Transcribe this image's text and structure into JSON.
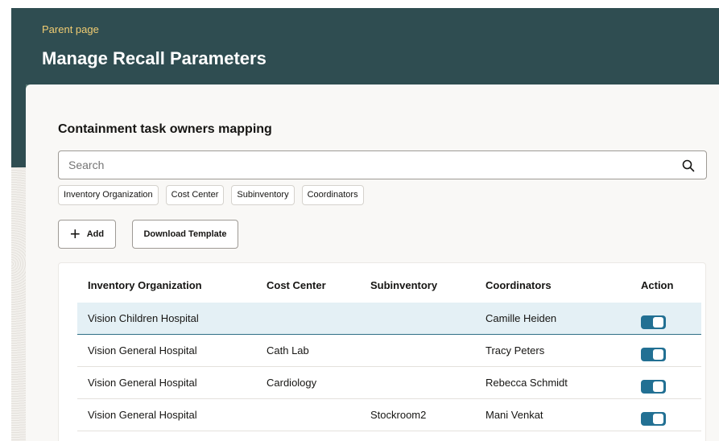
{
  "header": {
    "parent_link": "Parent page",
    "title": "Manage Recall Parameters"
  },
  "section": {
    "title": "Containment task owners mapping"
  },
  "search": {
    "placeholder": "Search",
    "icon": "search-icon"
  },
  "filter_chips": [
    "Inventory Organization",
    "Cost Center",
    "Subinventory",
    "Coordinators"
  ],
  "toolbar": {
    "add_label": "Add",
    "add_icon": "plus-icon",
    "download_label": "Download Template"
  },
  "table": {
    "columns": [
      "Inventory Organization",
      "Cost Center",
      "Subinventory",
      "Coordinators",
      "Action"
    ],
    "rows": [
      {
        "org": "Vision Children Hospital",
        "cost_center": "",
        "subinventory": "",
        "coordinator": "Camille Heiden",
        "action_enabled": true,
        "selected": true
      },
      {
        "org": "Vision General Hospital",
        "cost_center": "Cath Lab",
        "subinventory": "",
        "coordinator": "Tracy Peters",
        "action_enabled": true,
        "selected": false
      },
      {
        "org": "Vision General Hospital",
        "cost_center": "Cardiology",
        "subinventory": "",
        "coordinator": "Rebecca Schmidt",
        "action_enabled": true,
        "selected": false
      },
      {
        "org": "Vision General Hospital",
        "cost_center": "",
        "subinventory": "Stockroom2",
        "coordinator": "Mani Venkat",
        "action_enabled": true,
        "selected": false
      }
    ]
  },
  "colors": {
    "header_bg": "#2f4d51",
    "parent_link": "#f0cc72",
    "toggle_on": "#227093",
    "selected_row": "#e4f0f5"
  }
}
